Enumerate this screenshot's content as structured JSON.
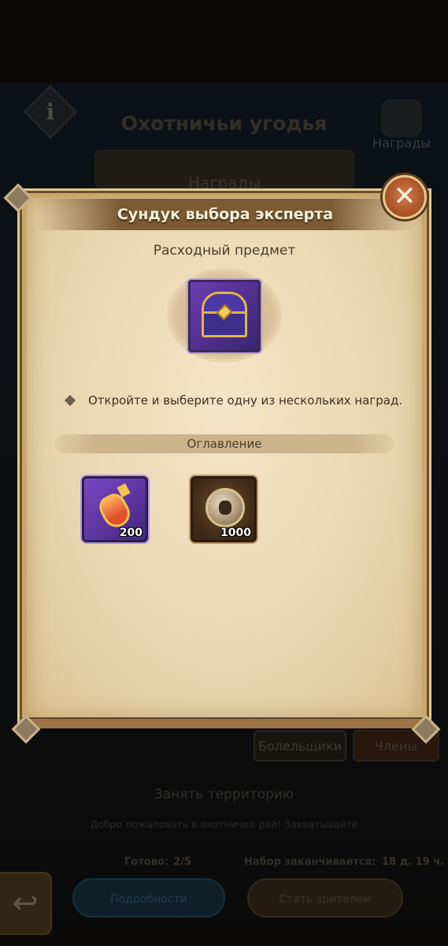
{
  "background": {
    "title": "Охотничьи угодья",
    "info_glyph": "i",
    "rewards_label": "Награды",
    "banner_label": "Награды",
    "tabs": [
      {
        "label": "Болельщики"
      },
      {
        "label": "Члены"
      }
    ],
    "occupy_title": "Занять территорию",
    "welcome_text": "Добро пожаловать в охотничий рай! Захватывайте",
    "ready_label": "Готово:",
    "ready_value": "2/5",
    "recruit_ends_label": "Набор заканчивается:",
    "recruit_ends_value": "18 д. 19 ч.",
    "details_button": "Подробности",
    "spectate_button": "Стать зрителем",
    "back_icon": "back-arrow-icon"
  },
  "modal": {
    "title": "Сундук выбора эксперта",
    "subtitle": "Расходный предмет",
    "item_icon": "treasure-chest-icon",
    "description": "Откройте и выберите одну из нескольких наград.",
    "contents_label": "Оглавление",
    "close_glyph": "✕",
    "rewards": [
      {
        "icon": "potion-icon",
        "quantity": "200"
      },
      {
        "icon": "medal-icon",
        "quantity": "1000"
      }
    ]
  },
  "colors": {
    "parchment": "#ead7b1",
    "header_brown": "#7b5a34",
    "close_orange": "#a44f24",
    "epic_purple": "#6b3db1"
  }
}
